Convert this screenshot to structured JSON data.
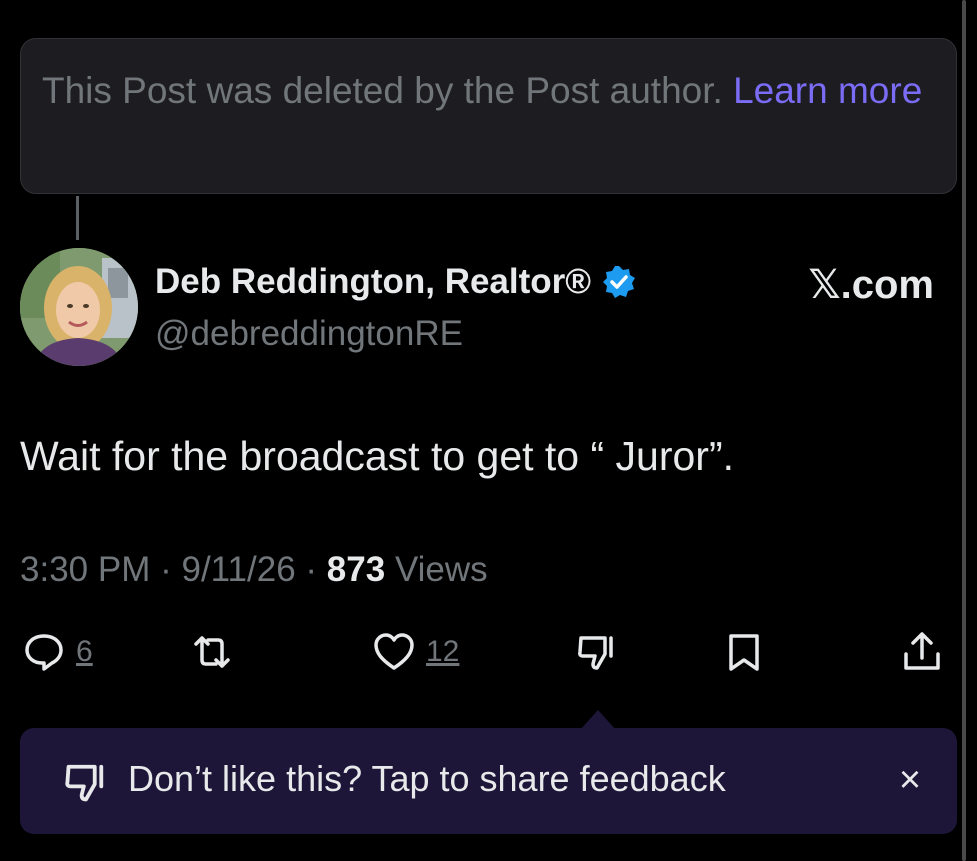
{
  "deleted_notice": {
    "text": "This Post was deleted by the Post author.",
    "link_label": "Learn more"
  },
  "author": {
    "name": "Deb Reddington, Realtor®",
    "handle": "@debreddingtonRE",
    "verified": true,
    "verified_color": "#1d9bf0"
  },
  "watermark": "𝕏.com",
  "post": {
    "text": "Wait for the broadcast to get to “ Juror”."
  },
  "meta": {
    "time": "3:30 PM",
    "date": "9/11/26",
    "views_count": "873",
    "views_label": "Views"
  },
  "actions": {
    "reply_count": "6",
    "like_count": "12",
    "icons": [
      "reply-icon",
      "repost-icon",
      "like-icon",
      "dislike-icon",
      "bookmark-icon",
      "share-icon"
    ]
  },
  "feedback": {
    "text": "Don’t like this? Tap to share feedback",
    "close_label": "×"
  },
  "colors": {
    "background": "#000000",
    "accent_link": "#7b6cf6",
    "muted_text": "#71767b",
    "feedback_bg": "#1e1638"
  }
}
